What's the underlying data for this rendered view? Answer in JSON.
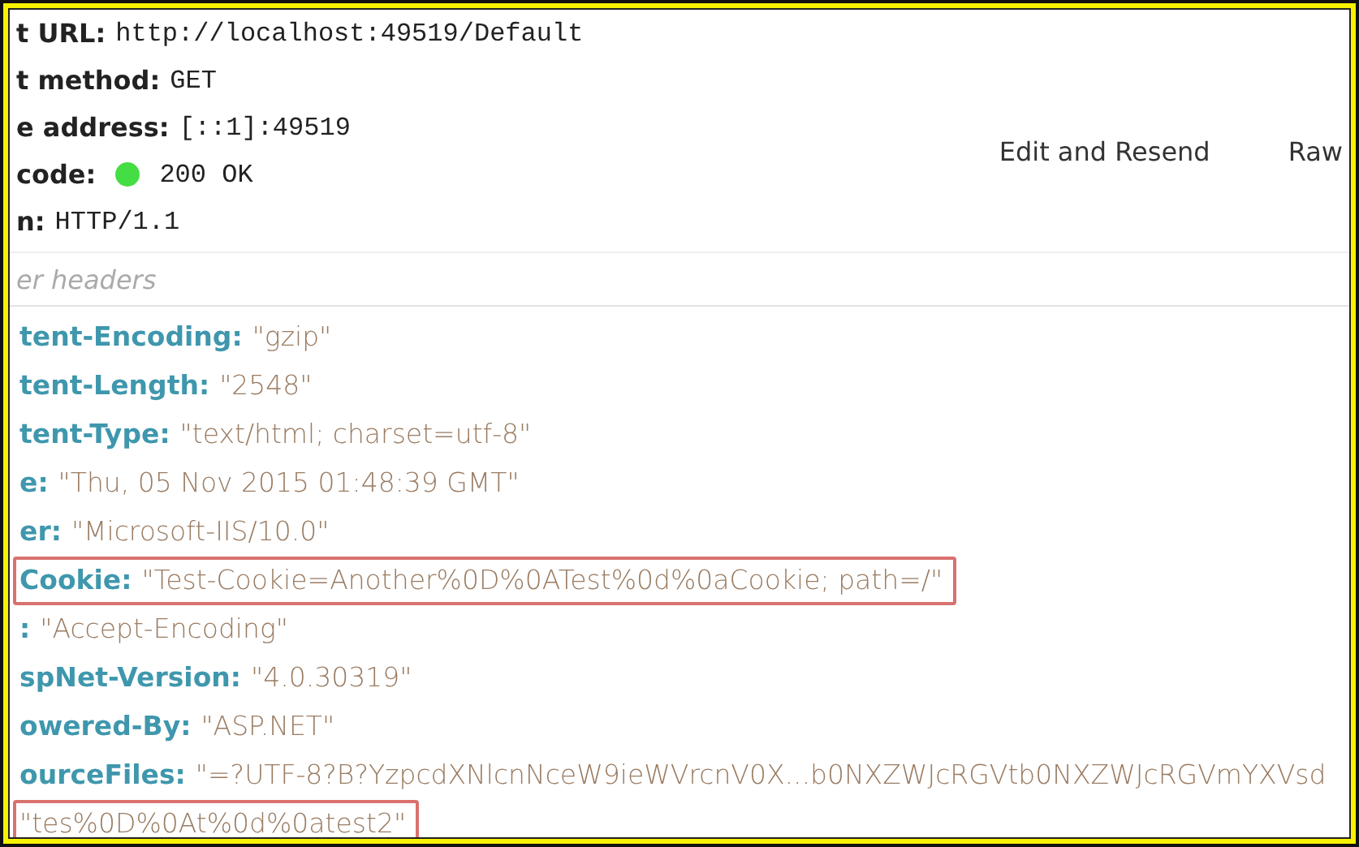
{
  "summary": [
    {
      "label": "t URL:",
      "value": "http://localhost:49519/Default"
    },
    {
      "label": "t method:",
      "value": "GET"
    },
    {
      "label": "e address:",
      "value": "[::1]:49519"
    },
    {
      "label": "code:",
      "value": "200 OK",
      "color": "#44dd44"
    },
    {
      "label": "n:",
      "value": "HTTP/1.1"
    }
  ],
  "actions": [
    "Edit and Resend",
    "Raw"
  ],
  "filter": {
    "placeholder": "er headers"
  },
  "headers": [
    {
      "name": "tent-Encoding:",
      "value": "\"gzip\"",
      "highlighted": false
    },
    {
      "name": "tent-Length:",
      "value": "\"2548\"",
      "highlighted": false
    },
    {
      "name": "tent-Type:",
      "value": "\"text/html; charset=utf-8\"",
      "highlighted": false
    },
    {
      "name": "e:",
      "value": "\"Thu, 05 Nov 2015 01:48:39 GMT\"",
      "highlighted": false
    },
    {
      "name": "er:",
      "value": "\"Microsoft-IIS/10.0\"",
      "highlighted": false
    },
    {
      "name": "Cookie:",
      "value": "\"Test-Cookie=Another%0D%0ATest%0d%0aCookie; path=/\"",
      "highlighted": true
    },
    {
      "name": ":",
      "value": "\"Accept-Encoding\"",
      "highlighted": false
    },
    {
      "name": "spNet-Version:",
      "value": "\"4.0.30319\"",
      "highlighted": false
    },
    {
      "name": "owered-By:",
      "value": "\"ASP.NET\"",
      "highlighted": false
    },
    {
      "name": "ourceFiles:",
      "value": "\"=?UTF-8?B?YzpcdXNlcnNceW9ieWVrcnV0X...b0NXZWJcRGVtb0NXZWJcRGVmYXVsd",
      "highlighted": false
    },
    {
      "value": "\"tes%0D%0At%0d%0atest2\"",
      "highlighted": true
    }
  ]
}
